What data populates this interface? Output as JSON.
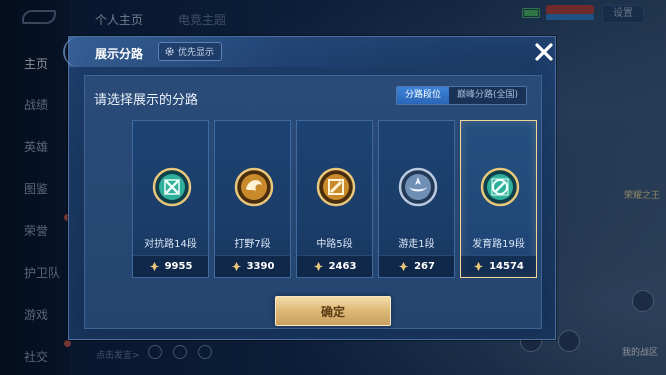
{
  "background": {
    "top_tabs": [
      "个人主页",
      "电竞主题"
    ],
    "settings_label": "设置",
    "nav_items": [
      "主页",
      "战绩",
      "英雄",
      "图鉴",
      "荣誉",
      "护卫队",
      "游戏",
      "社交"
    ],
    "chat_label": "点击发言>",
    "right_deco_text": "荣耀之王",
    "right_deco_text2": "我的战区"
  },
  "modal": {
    "title": "展示分路",
    "priority_label": "优先显示",
    "prompt": "请选择展示的分路",
    "toggle": {
      "option_segment": "分路段位",
      "option_peak": "巅峰分路(全国)"
    },
    "lanes": [
      {
        "label": "对抗路14段",
        "score": "9955",
        "emblem": "clash-lane-emblem-icon",
        "color": "#2fae9b"
      },
      {
        "label": "打野7段",
        "score": "3390",
        "emblem": "jungle-emblem-icon",
        "color": "#c88a2a"
      },
      {
        "label": "中路5段",
        "score": "2463",
        "emblem": "mid-lane-emblem-icon",
        "color": "#c88a2a"
      },
      {
        "label": "游走1段",
        "score": "267",
        "emblem": "roam-emblem-icon",
        "color": "#6f8fb5"
      },
      {
        "label": "发育路19段",
        "score": "14574",
        "emblem": "farm-lane-emblem-icon",
        "color": "#2fae9b"
      }
    ],
    "selected_index": 4,
    "confirm_label": "确定"
  },
  "colors": {
    "accent_gold": "#f0d49c",
    "toggle_blue": "#3c83d8"
  }
}
